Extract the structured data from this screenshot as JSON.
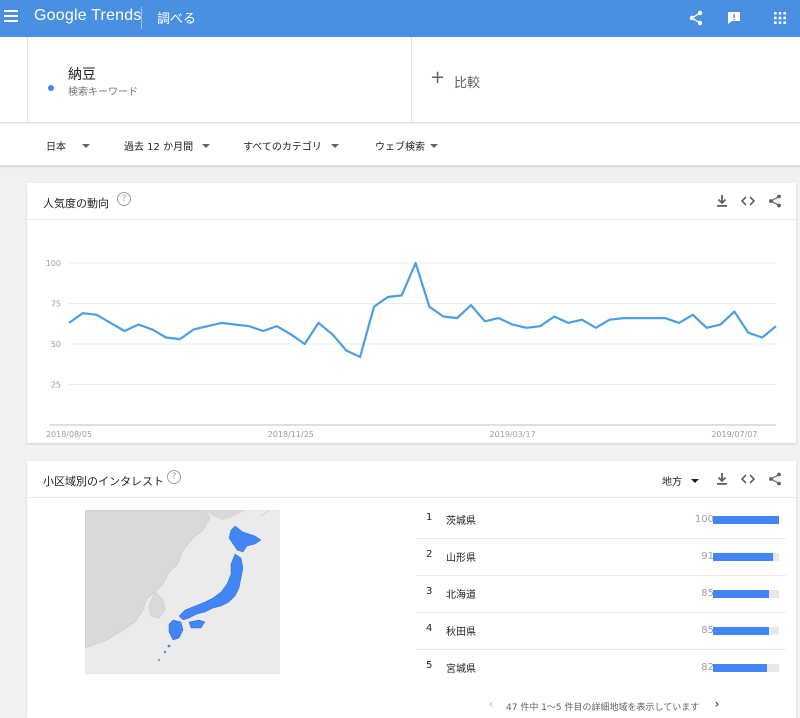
{
  "header": {
    "logo_google": "Google",
    "logo_trends": "Trends",
    "search_label": "調べる",
    "icons": [
      "menu-icon",
      "share-icon",
      "feedback-icon",
      "apps-icon"
    ]
  },
  "term": {
    "name": "納豆",
    "subtitle": "検索キーワード",
    "color": "#4285f4",
    "compare_label": "比較"
  },
  "filters": [
    {
      "label": "日本"
    },
    {
      "label": "過去 12 か月間"
    },
    {
      "label": "すべてのカテゴリ"
    },
    {
      "label": "ウェブ検索"
    }
  ],
  "interest_over_time": {
    "title": "人気度の動向",
    "help": "?"
  },
  "chart_data": {
    "type": "line",
    "title": "人気度の動向",
    "xlabel": "",
    "ylabel": "",
    "ylim": [
      0,
      100
    ],
    "y_ticks": [
      "100",
      "75",
      "50",
      "25"
    ],
    "x_tick_labels": [
      "2018/08/05",
      "2018/11/25",
      "2019/03/17",
      "2019/07/07"
    ],
    "grid": true,
    "series": [
      {
        "color": "#4a9fe6",
        "values": [
          63,
          69,
          68,
          63,
          58,
          62,
          59,
          54,
          53,
          59,
          61,
          63,
          62,
          61,
          58,
          61,
          56,
          50,
          63,
          56,
          46,
          42,
          73,
          79,
          80,
          100,
          73,
          67,
          66,
          74,
          64,
          66,
          62,
          60,
          61,
          67,
          63,
          65,
          60,
          65,
          66,
          66,
          66,
          66,
          63,
          68,
          60,
          62,
          70,
          57,
          54,
          61
        ]
      }
    ]
  },
  "interest_by_region": {
    "title": "小区域別のインタレスト",
    "help": "?",
    "region_selector": "地方",
    "rows": [
      {
        "rank": "1",
        "name": "茨城県",
        "value": "100",
        "level": 100
      },
      {
        "rank": "2",
        "name": "山形県",
        "value": "91",
        "level": 91
      },
      {
        "rank": "3",
        "name": "北海道",
        "value": "85",
        "level": 85
      },
      {
        "rank": "4",
        "name": "秋田県",
        "value": "85",
        "level": 85
      },
      {
        "rank": "5",
        "name": "宮城県",
        "value": "82",
        "level": 82
      }
    ],
    "pager_text": "47 件中 1〜5 件目の詳細地域を表示しています",
    "map_color": "#4285f4"
  }
}
